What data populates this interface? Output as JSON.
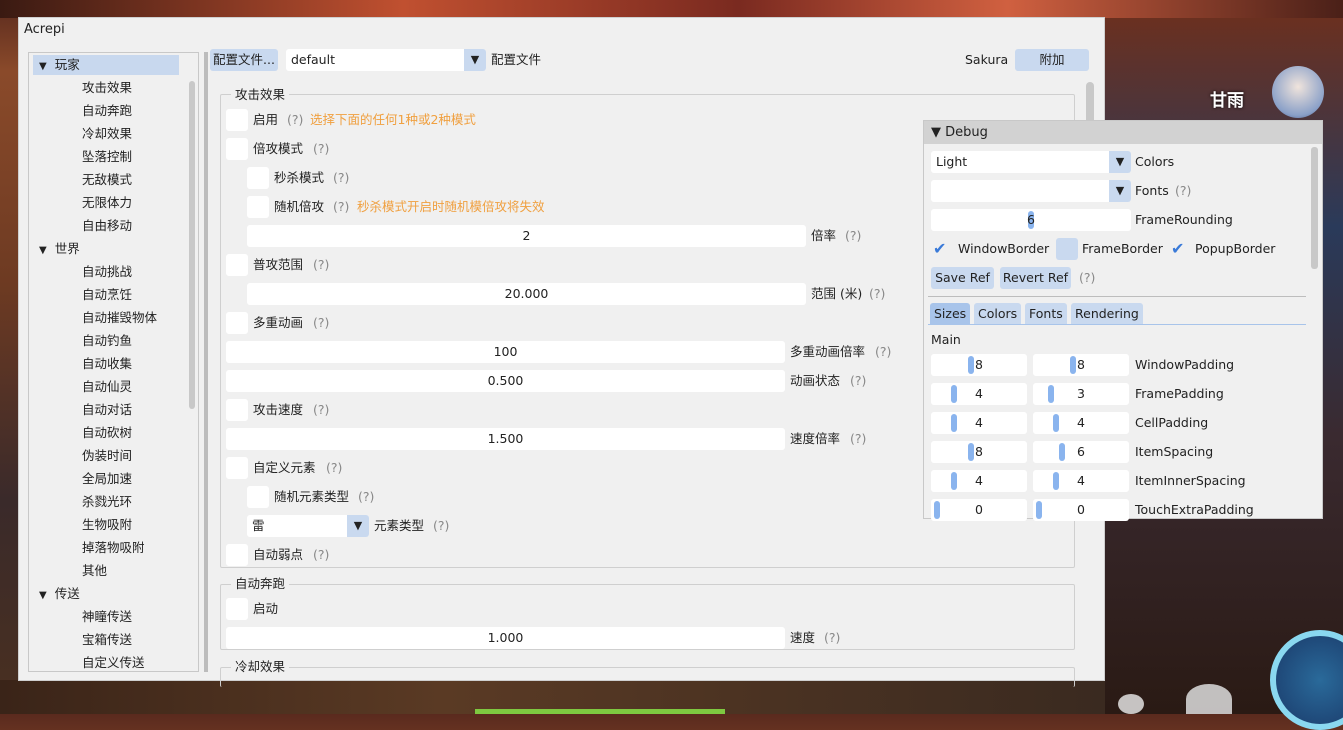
{
  "window": {
    "title": "Acrepi"
  },
  "hud": {
    "character_name": "甘雨"
  },
  "tree": {
    "sections": [
      {
        "label": "玩家",
        "items": [
          "攻击效果",
          "自动奔跑",
          "冷却效果",
          "坠落控制",
          "无敌模式",
          "无限体力",
          "自由移动"
        ]
      },
      {
        "label": "世界",
        "items": [
          "自动挑战",
          "自动烹饪",
          "自动摧毁物体",
          "自动钓鱼",
          "自动收集",
          "自动仙灵",
          "自动对话",
          "自动砍树",
          "伪装时间",
          "全局加速",
          "杀戮光环",
          "生物吸附",
          "掉落物吸附",
          "其他"
        ]
      },
      {
        "label": "传送",
        "items": [
          "神瞳传送",
          "宝箱传送",
          "自定义传送"
        ]
      }
    ]
  },
  "top": {
    "config_button": "配置文件...",
    "config_value": "default",
    "config_label": "配置文件",
    "user": "Sakura",
    "attach_button": "附加"
  },
  "attack": {
    "title": "攻击效果",
    "enable": "启用",
    "help": "(?)",
    "enable_hint": "选择下面的任何1种或2种模式",
    "multiplier_mode": "倍攻模式",
    "kill_mode": "秒杀模式",
    "random_multiplier": "随机倍攻",
    "random_hint": "秒杀模式开启时随机模倍攻将失效",
    "rate_value": "2",
    "rate_label": "倍率",
    "range_attack": "普攻范围",
    "range_value": "20.000",
    "range_label": "范围 (米)",
    "multi_anim": "多重动画",
    "multi_anim_rate_value": "100",
    "multi_anim_rate_label": "多重动画倍率",
    "anim_state_value": "0.500",
    "anim_state_label": "动画状态",
    "attack_speed": "攻击速度",
    "speed_rate_value": "1.500",
    "speed_rate_label": "速度倍率",
    "custom_element": "自定义元素",
    "random_element": "随机元素类型",
    "element_value": "雷",
    "element_label": "元素类型",
    "auto_weakpoint": "自动弱点"
  },
  "autorun": {
    "title": "自动奔跑",
    "enable": "启动",
    "speed_value": "1.000",
    "speed_label": "速度"
  },
  "cooldown": {
    "title": "冷却效果"
  },
  "debug": {
    "title": "Debug",
    "colors_value": "Light",
    "colors_label": "Colors",
    "fonts_label": "Fonts",
    "rounding_value": "6",
    "rounding_label": "FrameRounding",
    "window_border": "WindowBorder",
    "frame_border": "FrameBorder",
    "popup_border": "PopupBorder",
    "save_ref": "Save Ref",
    "revert_ref": "Revert Ref",
    "tabs": [
      "Sizes",
      "Colors",
      "Fonts",
      "Rendering"
    ],
    "main_label": "Main",
    "rows": [
      {
        "label": "WindowPadding",
        "a": "8",
        "b": "8"
      },
      {
        "label": "FramePadding",
        "a": "4",
        "b": "3"
      },
      {
        "label": "CellPadding",
        "a": "4",
        "b": "4"
      },
      {
        "label": "ItemSpacing",
        "a": "8",
        "b": "6"
      },
      {
        "label": "ItemInnerSpacing",
        "a": "4",
        "b": "4"
      },
      {
        "label": "TouchExtraPadding",
        "a": "0",
        "b": "0"
      }
    ]
  },
  "icons": {
    "tree_open": "triangle-down-icon",
    "combo_arrow": "triangle-down-icon",
    "check": "checkmark-icon"
  }
}
